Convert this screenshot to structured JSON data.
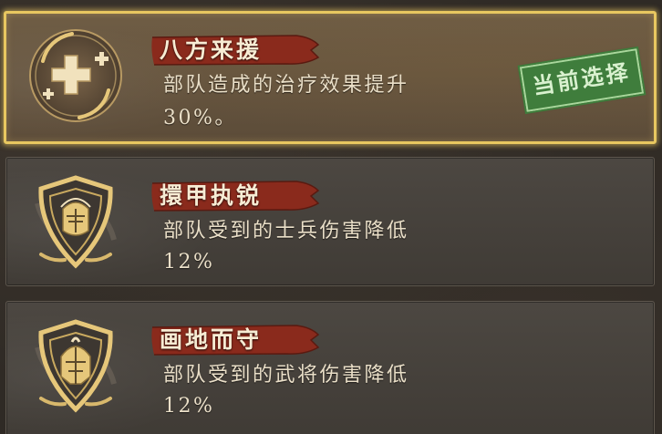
{
  "colors": {
    "selected_border": "#e8c760",
    "title_plate": "#8a2a1c",
    "stamp_green": "#3f7d3c",
    "icon_gold": "#e6c77a",
    "text": "#eadfc8"
  },
  "options": [
    {
      "title": "八方来援",
      "desc_line1": "部队造成的治疗效果提升",
      "desc_line2": "30%。",
      "icon": "healing-cross-icon",
      "selected": true
    },
    {
      "title": "擐甲执锐",
      "desc_line1": "部队受到的士兵伤害降低",
      "desc_line2": "12%",
      "icon": "soldier-shield-icon",
      "selected": false
    },
    {
      "title": "画地而守",
      "desc_line1": "部队受到的武将伤害降低",
      "desc_line2": "12%",
      "icon": "general-shield-icon",
      "selected": false
    }
  ],
  "current_selection_stamp": "当前选择"
}
